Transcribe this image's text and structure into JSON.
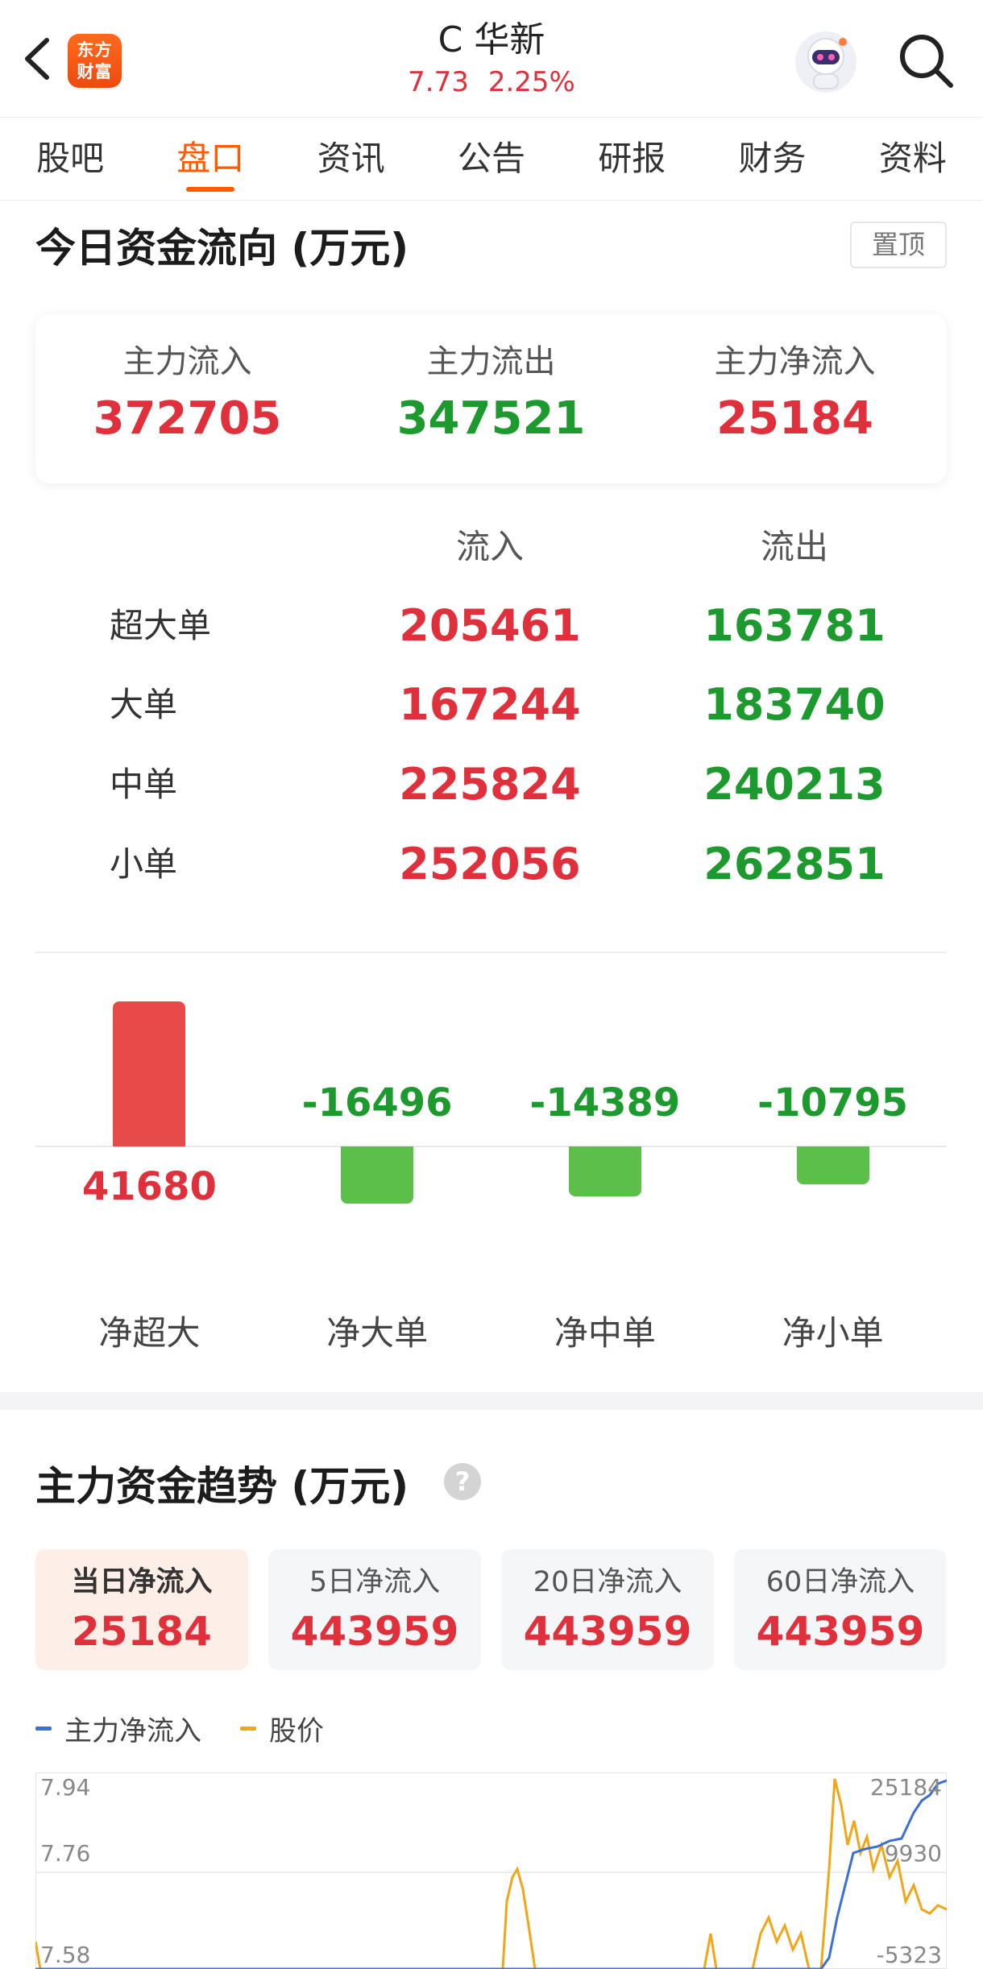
{
  "header": {
    "logo_line1": "东方",
    "logo_line2": "财富",
    "stock_name": "C 华新",
    "price": "7.73",
    "change_pct": "2.25%"
  },
  "tabs": [
    {
      "label": "股吧",
      "active": false
    },
    {
      "label": "盘口",
      "active": true
    },
    {
      "label": "资讯",
      "active": false
    },
    {
      "label": "公告",
      "active": false
    },
    {
      "label": "研报",
      "active": false
    },
    {
      "label": "财务",
      "active": false
    },
    {
      "label": "资料",
      "active": false
    }
  ],
  "capital_flow": {
    "title": "今日资金流向 (万元)",
    "pin_label": "置顶",
    "summary": [
      {
        "label": "主力流入",
        "value": "372705",
        "color": "red"
      },
      {
        "label": "主力流出",
        "value": "347521",
        "color": "green"
      },
      {
        "label": "主力净流入",
        "value": "25184",
        "color": "red"
      }
    ],
    "col_in": "流入",
    "col_out": "流出",
    "rows": [
      {
        "label": "超大单",
        "in": "205461",
        "out": "163781"
      },
      {
        "label": "大单",
        "in": "167244",
        "out": "183740"
      },
      {
        "label": "中单",
        "in": "225824",
        "out": "240213"
      },
      {
        "label": "小单",
        "in": "252056",
        "out": "262851"
      }
    ]
  },
  "chart_data": {
    "type": "bar",
    "categories": [
      "净超大",
      "净大单",
      "净中单",
      "净小单"
    ],
    "values": [
      41680,
      -16496,
      -14389,
      -10795
    ]
  },
  "trend": {
    "title": "主力资金趋势 (万元)",
    "help_icon": "question-icon",
    "periods": [
      {
        "label": "当日净流入",
        "value": "25184",
        "active": true
      },
      {
        "label": "5日净流入",
        "value": "443959",
        "active": false
      },
      {
        "label": "20日净流入",
        "value": "443959",
        "active": false
      },
      {
        "label": "60日净流入",
        "value": "443959",
        "active": false
      }
    ],
    "legend": [
      {
        "label": "主力净流入",
        "color": "#3b6fd8"
      },
      {
        "label": "股价",
        "color": "#f2a516"
      }
    ],
    "y_left": [
      "7.94",
      "7.76",
      "7.58"
    ],
    "y_right": [
      "25184",
      "9930",
      "-5323"
    ]
  }
}
